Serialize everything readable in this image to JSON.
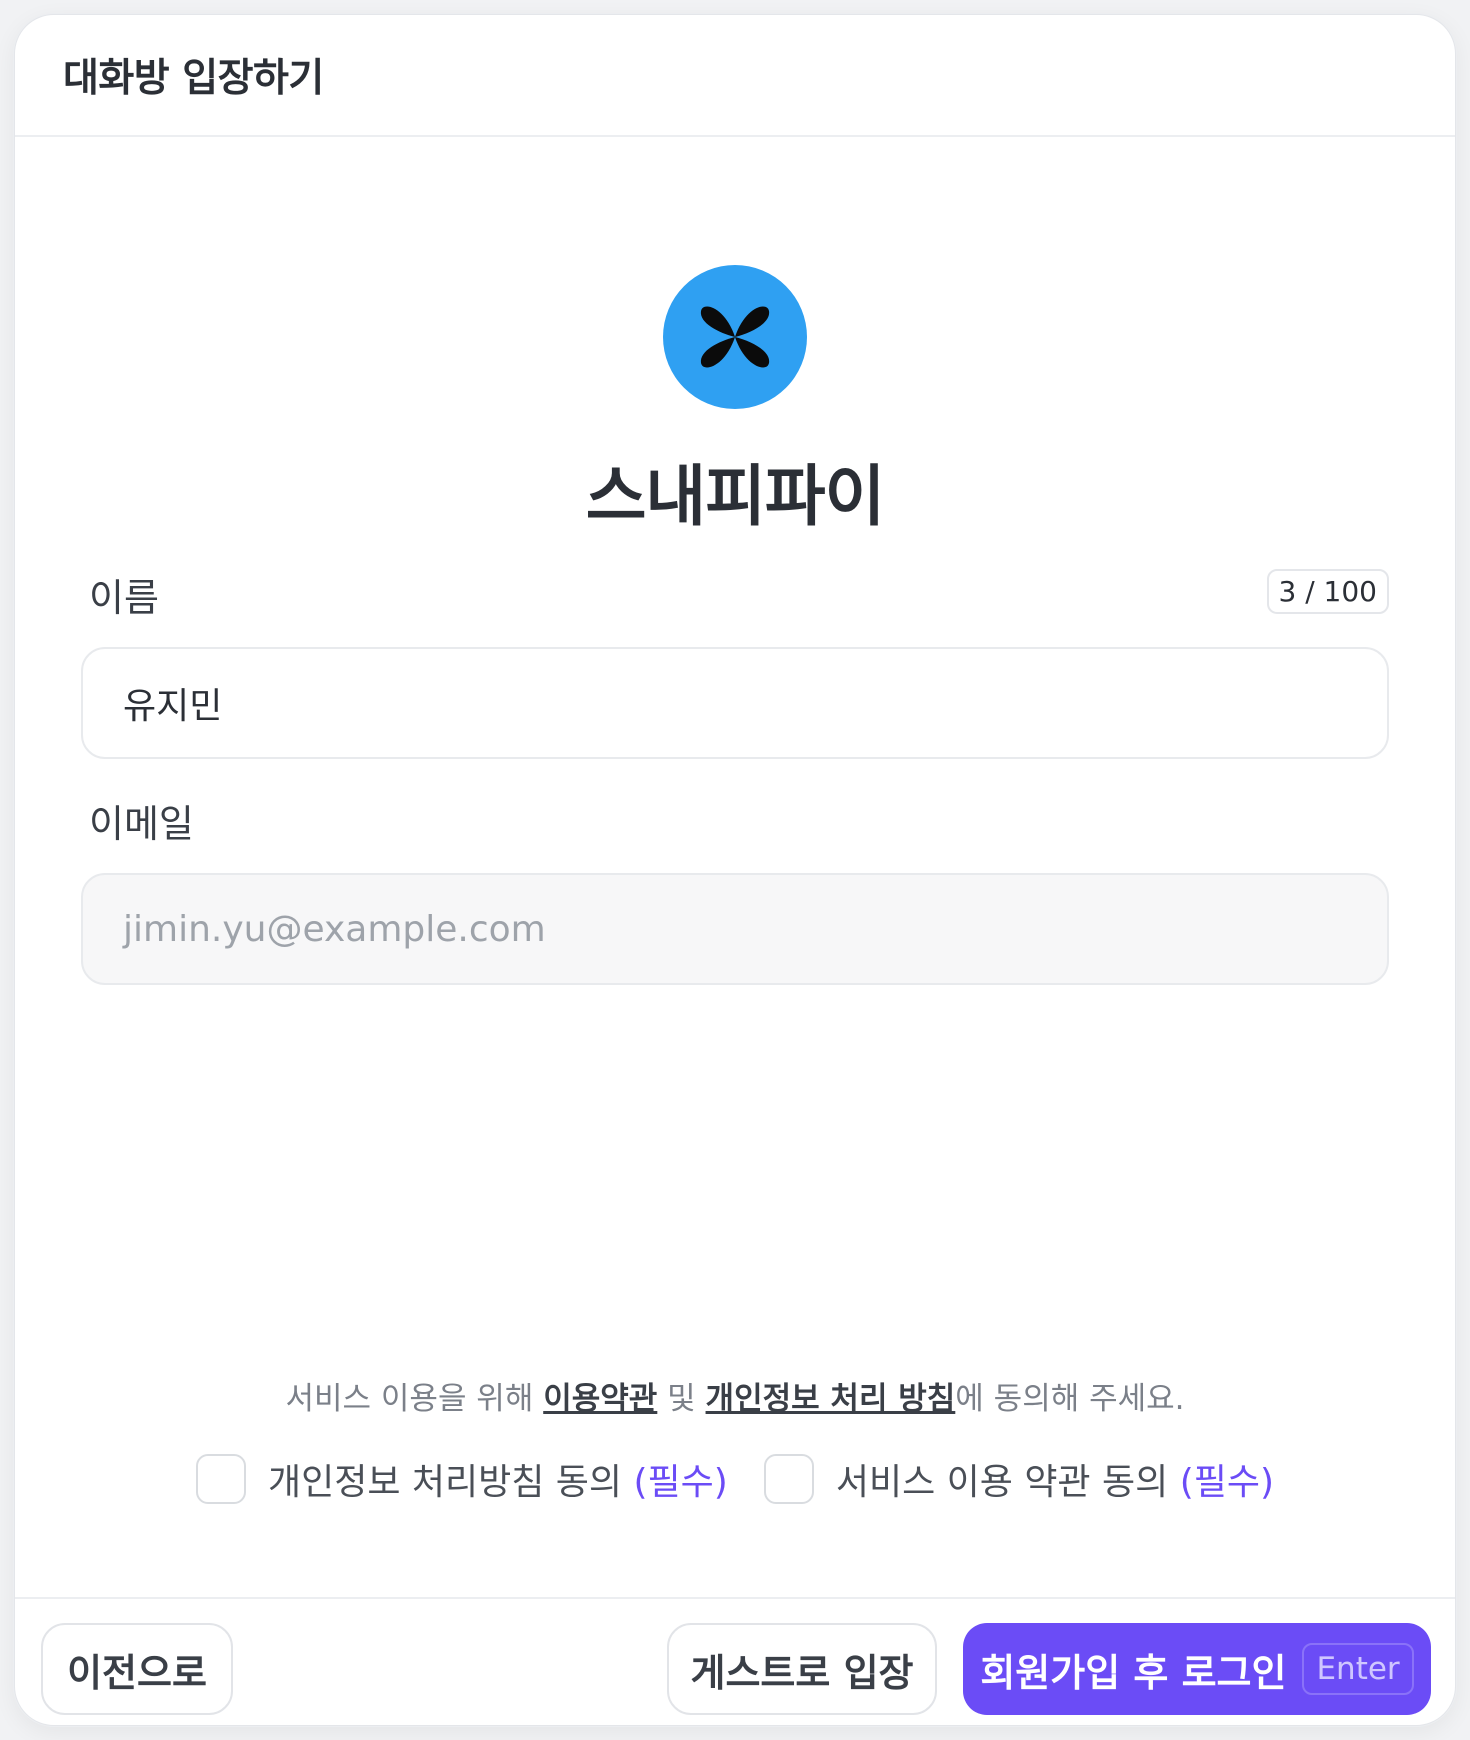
{
  "modal": {
    "title": "대화방 입장하기"
  },
  "brand": {
    "name": "스내피파이",
    "logo_icon": "butterfly-x-icon",
    "logo_color": "#2fa0f2"
  },
  "form": {
    "name": {
      "label": "이름",
      "value": "유지민",
      "counter": "3 / 100"
    },
    "email": {
      "label": "이메일",
      "value": "",
      "placeholder": "jimin.yu@example.com"
    }
  },
  "consent": {
    "prefix": "서비스 이용을 위해 ",
    "terms_link": "이용약관",
    "middle": " 및 ",
    "privacy_link": "개인정보 처리 방침",
    "suffix": "에 동의해 주세요.",
    "checkboxes": [
      {
        "label": "개인정보 처리방침 동의 ",
        "required": "(필수)",
        "checked": false
      },
      {
        "label": "서비스 이용 약관 동의 ",
        "required": "(필수)",
        "checked": false
      }
    ]
  },
  "footer": {
    "back_label": "이전으로",
    "guest_label": "게스트로 입장",
    "primary_label": "회원가입 후 로그인",
    "primary_shortcut": "Enter"
  },
  "colors": {
    "accent": "#6b4cf6",
    "required_text": "#6b4cf6"
  }
}
